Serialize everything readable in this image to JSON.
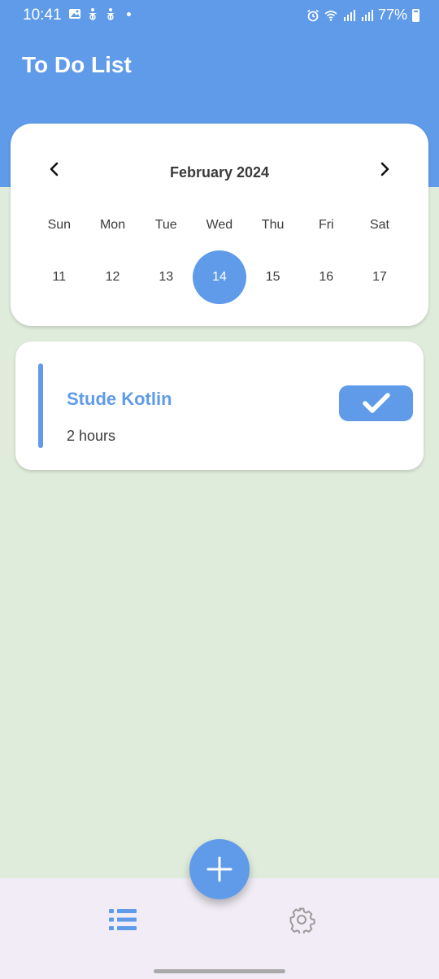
{
  "status_bar": {
    "time": "10:41",
    "battery": "77%",
    "left_icons": [
      "image-icon",
      "accessibility-icon",
      "accessibility-icon"
    ],
    "right_icons": [
      "alarm-icon",
      "wifi-icon",
      "signal-icon",
      "signal-icon",
      "battery-icon"
    ]
  },
  "header": {
    "title": "To Do List"
  },
  "calendar": {
    "month": "February 2024",
    "weekdays": [
      "Sun",
      "Mon",
      "Tue",
      "Wed",
      "Thu",
      "Fri",
      "Sat"
    ],
    "days": [
      "11",
      "12",
      "13",
      "14",
      "15",
      "16",
      "17"
    ],
    "selected_day": "14"
  },
  "task": {
    "title": "Stude Kotlin",
    "duration": "2 hours",
    "done_icon": "check-icon"
  },
  "fab": {
    "icon": "plus-icon"
  },
  "bottom_nav": {
    "items": [
      {
        "icon": "list-icon",
        "active": true
      },
      {
        "icon": "gear-icon",
        "active": false
      }
    ]
  },
  "colors": {
    "primary": "#5f9be9",
    "background": "#dfebdb",
    "nav_background": "#f1ecf5"
  }
}
